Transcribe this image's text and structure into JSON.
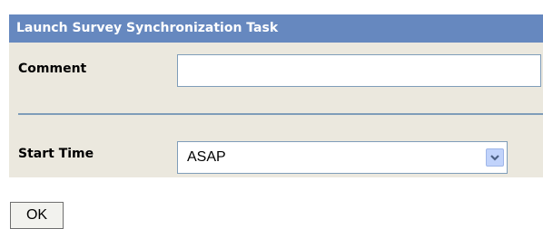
{
  "panel": {
    "title": "Launch Survey Synchronization Task",
    "header_color": "#6688bf",
    "background_color": "#ebe8de"
  },
  "comment": {
    "label": "Comment",
    "value": "",
    "placeholder": ""
  },
  "start_time": {
    "label": "Start Time",
    "selected": "ASAP",
    "arrow_icon": "chevron-down-icon"
  },
  "actions": {
    "ok_label": "OK"
  }
}
